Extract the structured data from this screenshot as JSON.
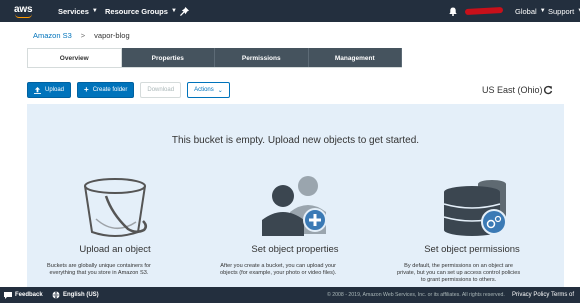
{
  "nav": {
    "logo": "aws",
    "services": "Services",
    "resource_groups": "Resource Groups",
    "region": "Global",
    "support": "Support"
  },
  "breadcrumb": {
    "root": "Amazon S3",
    "separator": ">",
    "current": "vapor-blog"
  },
  "tabs": [
    {
      "label": "Overview",
      "active": true
    },
    {
      "label": "Properties",
      "active": false
    },
    {
      "label": "Permissions",
      "active": false
    },
    {
      "label": "Management",
      "active": false
    }
  ],
  "toolbar": {
    "upload": "Upload",
    "create_folder": "Create folder",
    "download": "Download",
    "actions": "Actions",
    "region": "US East (Ohio)"
  },
  "empty_state": {
    "message": "This bucket is empty. Upload new objects to get started.",
    "columns": [
      {
        "icon": "bucket-icon",
        "title": "Upload an object",
        "desc_line1": "Buckets are globally unique containers for",
        "desc_line2": "everything that you store in Amazon S3."
      },
      {
        "icon": "users-add-icon",
        "title": "Set object properties",
        "desc_line1": "After you create a bucket, you can upload your",
        "desc_line2": "objects (for example, your photo or video files)."
      },
      {
        "icon": "database-gear-icon",
        "title": "Set object permissions",
        "desc_line1": "By default, the permissions on an object are",
        "desc_line2": "private, but you can set up access control policies",
        "desc_line3": "to grant permissions to others."
      }
    ]
  },
  "footer": {
    "feedback": "Feedback",
    "language": "English (US)",
    "copyright": "© 2008 - 2019, Amazon Web Services, Inc. or its affiliates. All rights reserved.",
    "privacy": "Privacy Policy",
    "terms": "Terms of"
  },
  "colors": {
    "nav_bg": "#232f3e",
    "accent_blue": "#0073bb",
    "panel_bg": "#e4eff9",
    "tab_inactive": "#45535e",
    "aws_orange": "#ff9900"
  }
}
